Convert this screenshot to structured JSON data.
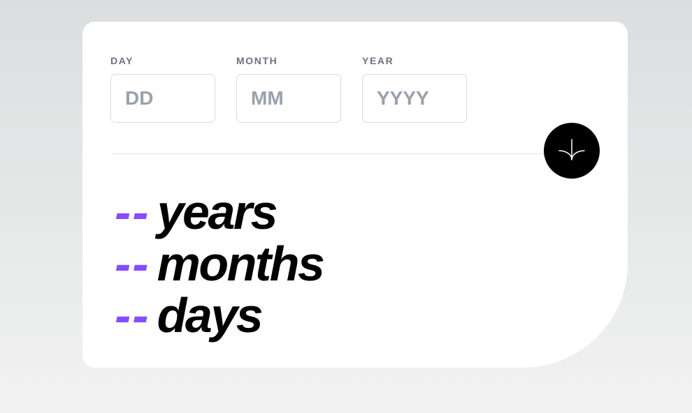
{
  "form": {
    "day": {
      "label": "DAY",
      "placeholder": "DD",
      "value": ""
    },
    "month": {
      "label": "MONTH",
      "placeholder": "MM",
      "value": ""
    },
    "year": {
      "label": "YEAR",
      "placeholder": "YYYY",
      "value": ""
    }
  },
  "submit": {
    "icon": "arrow-down-icon"
  },
  "results": {
    "years": {
      "value": "--",
      "unit": "years"
    },
    "months": {
      "value": "--",
      "unit": "months"
    },
    "days": {
      "value": "--",
      "unit": "days"
    }
  },
  "colors": {
    "accent": "#854dff",
    "button": "#000000",
    "label": "#6b7280",
    "placeholder": "#9aa1ae"
  }
}
